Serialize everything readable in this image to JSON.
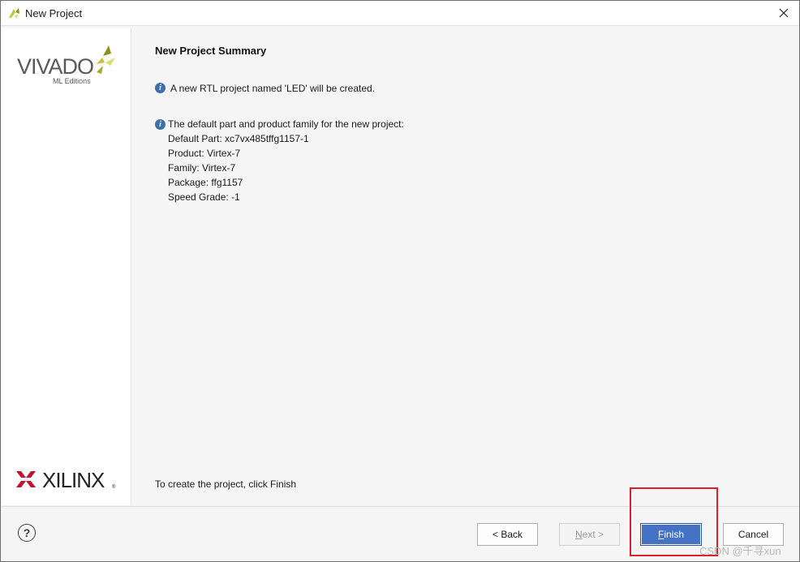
{
  "window": {
    "title": "New Project",
    "close_label": "✕"
  },
  "branding": {
    "vivado_name": "VIVADO",
    "vivado_edition": "ML Editions",
    "xilinx_name": "XILINX"
  },
  "page": {
    "title": "New Project Summary",
    "rtl_info": "A new RTL project named 'LED' will be created.",
    "part_info_heading": "The default part and product family for the new project:",
    "default_part": "Default Part: xc7vx485tffg1157-1",
    "product": "Product: Virtex-7",
    "family": "Family: Virtex-7",
    "package": "Package: ffg1157",
    "speed_grade": "Speed Grade: -1",
    "finish_hint": "To create the project, click Finish"
  },
  "buttons": {
    "help": "?",
    "back": "< Back",
    "next_mnemonic": "N",
    "next_rest": "ext >",
    "finish_mnemonic": "F",
    "finish_rest": "inish",
    "cancel": "Cancel"
  },
  "watermark": "CSDN @千寻xun",
  "colors": {
    "primary_button": "#4472c4",
    "info_icon": "#3e6fa8",
    "highlight_box": "#d9232a",
    "xilinx_red": "#c8102e",
    "vivado_leaf": "#c3c43a"
  }
}
